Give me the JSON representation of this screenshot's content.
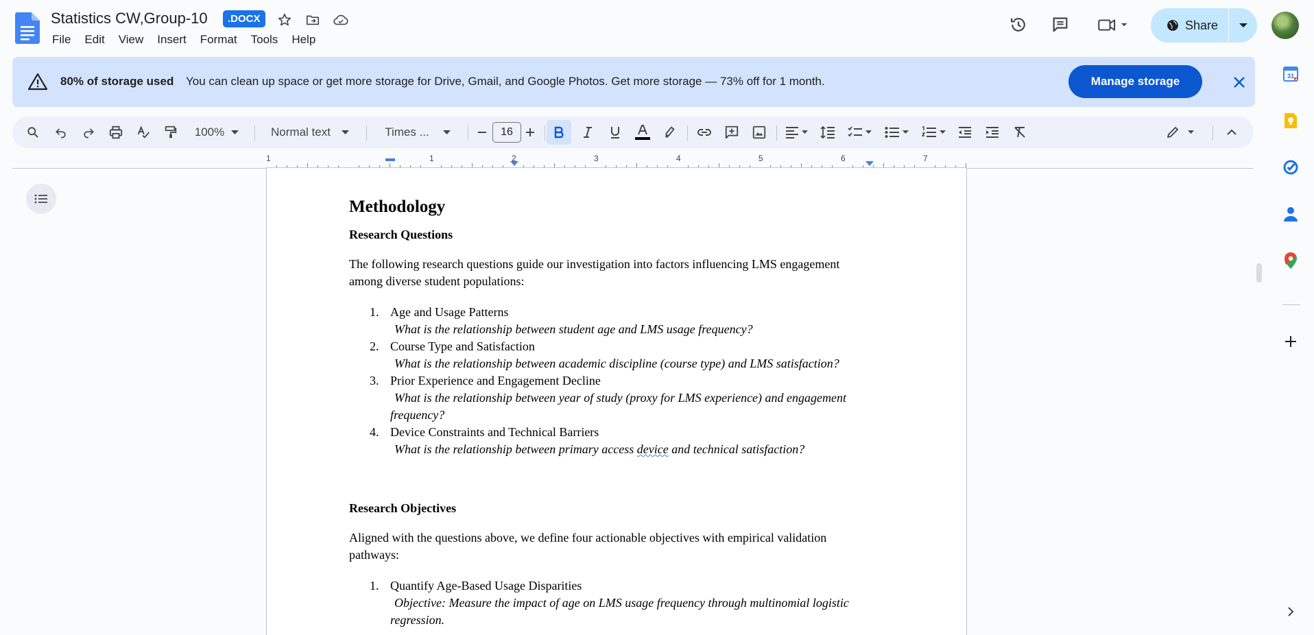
{
  "app": {
    "name": "Google Docs"
  },
  "title": {
    "doc_name": "Statistics CW,Group-10",
    "badge": ".DOCX"
  },
  "menu": [
    "File",
    "Edit",
    "View",
    "Insert",
    "Format",
    "Tools",
    "Help"
  ],
  "header_actions": {
    "share_label": "Share"
  },
  "banner": {
    "title": "80% of storage used",
    "message": "You can clean up space or get more storage for Drive, Gmail, and Google Photos. Get more storage — 73% off for 1 month.",
    "manage_label": "Manage storage"
  },
  "toolbar": {
    "zoom": "100%",
    "style": "Normal text",
    "font": "Times ...",
    "font_size": "16",
    "bold_active": true
  },
  "ruler": {
    "labels": [
      "1",
      "1",
      "2",
      "3",
      "4",
      "5",
      "6",
      "7"
    ]
  },
  "document": {
    "heading": "Methodology",
    "rq_heading": "Research Questions",
    "rq_intro_1": "The following research questions guide our investigation into factors influencing LMS engagement",
    "rq_intro_2": "among diverse student populations:",
    "questions": [
      {
        "num": "1.",
        "title": "Age and Usage Patterns",
        "q": "What is the relationship between student age and LMS usage frequency?"
      },
      {
        "num": "2.",
        "title": "Course Type and Satisfaction",
        "q": "What is the relationship between academic discipline (course type) and LMS satisfaction?"
      },
      {
        "num": "3.",
        "title": "Prior Experience and Engagement Decline",
        "q": "What is the relationship between year of study (proxy for LMS experience) and engagement",
        "q2": "frequency?"
      },
      {
        "num": "4.",
        "title": "Device Constraints and Technical Barriers",
        "q_pre": "What is the relationship between primary access ",
        "q_squig": "device",
        "q_post": " and technical satisfaction?"
      }
    ],
    "ro_heading": "Research Objectives",
    "ro_intro_1": "Aligned with the questions above, we define four actionable objectives with empirical validation",
    "ro_intro_2": "pathways:",
    "objectives": [
      {
        "num": "1.",
        "title": "Quantify Age-Based Usage Disparities",
        "o": "Objective: Measure the impact of age on LMS usage frequency through multinomial logistic",
        "o2": "regression."
      }
    ]
  },
  "colors": {
    "accent": "#0b57d0",
    "banner_bg": "#d3e3fd",
    "share_bg": "#c2e7ff",
    "toolbar_bg": "#edf2fa"
  }
}
